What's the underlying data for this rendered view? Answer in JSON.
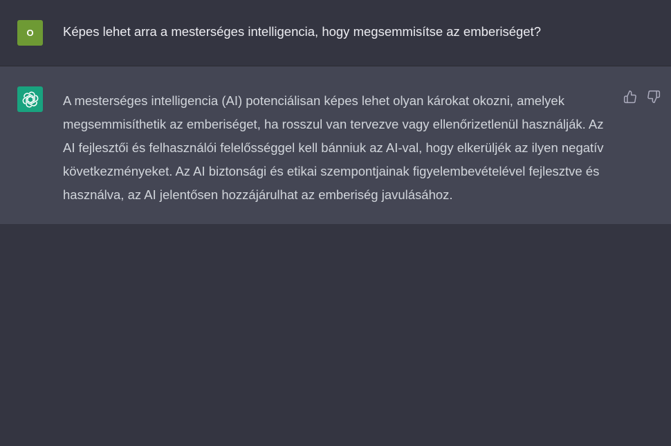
{
  "conversation": {
    "user_message": {
      "avatar_initial": "O",
      "text": "Képes lehet arra a mesterséges intelligencia, hogy megsemmisítse az emberiséget?"
    },
    "assistant_message": {
      "avatar_icon": "openai-logo-icon",
      "text": "A mesterséges intelligencia (AI) potenciálisan képes lehet olyan károkat okozni, amelyek megsemmisíthetik az emberiséget, ha rosszul van tervezve vagy ellenőrizetlenül használják. Az AI fejlesztői és felhasználói felelősséggel kell bánniuk az AI-val, hogy elkerüljék az ilyen negatív következményeket. Az AI biztonsági és etikai szempontjainak figyelembevételével fejlesztve és használva, az AI jelentősen hozzájárulhat az emberiség javulásához.",
      "feedback": {
        "thumbs_up_icon": "thumbs-up-icon",
        "thumbs_down_icon": "thumbs-down-icon"
      }
    }
  },
  "colors": {
    "background": "#343541",
    "assistant_row": "#444654",
    "user_avatar": "#6e9a34",
    "assistant_avatar": "#19a37f",
    "user_text": "#ececf1",
    "assistant_text": "#d1d5db"
  }
}
